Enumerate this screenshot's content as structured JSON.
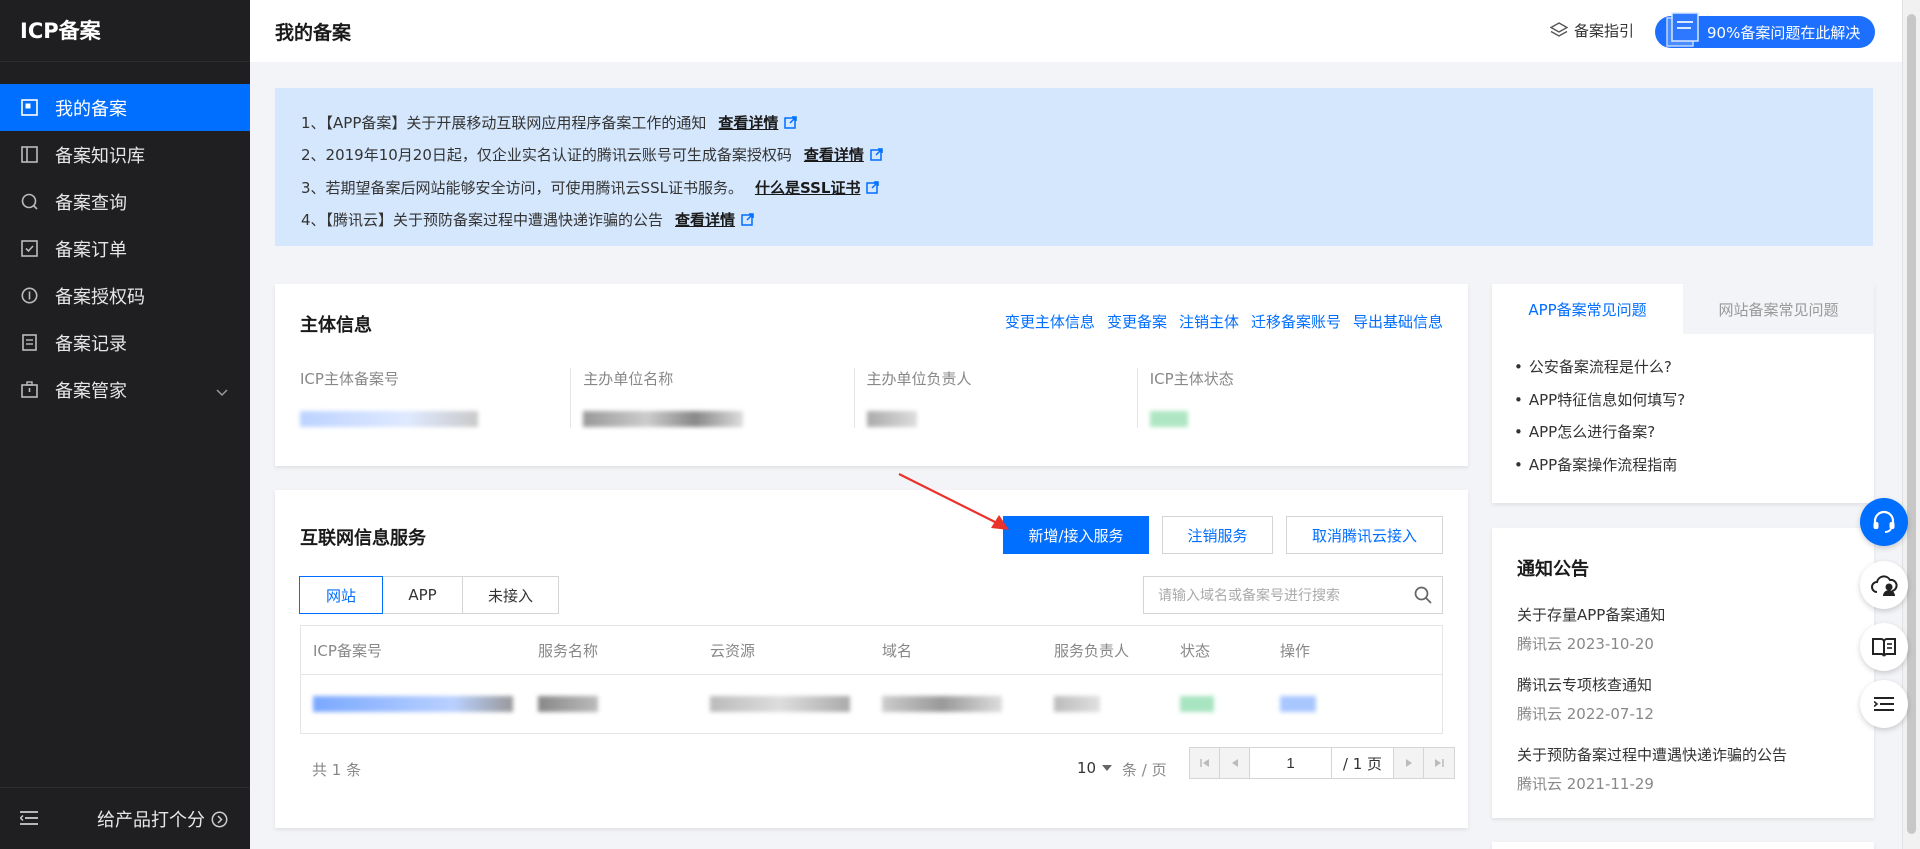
{
  "sidebar": {
    "title": "ICP备案",
    "items": [
      {
        "label": "我的备案"
      },
      {
        "label": "备案知识库"
      },
      {
        "label": "备案查询"
      },
      {
        "label": "备案订单"
      },
      {
        "label": "备案授权码"
      },
      {
        "label": "备案记录"
      },
      {
        "label": "备案管家"
      }
    ],
    "rate_label": "给产品打个分"
  },
  "header": {
    "title": "我的备案",
    "guide_label": "备案指引",
    "promo_label": "90%备案问题在此解决"
  },
  "notices": [
    {
      "text": "1、【APP备案】关于开展移动互联网应用程序备案工作的通知",
      "link": "查看详情"
    },
    {
      "text": "2、2019年10月20日起，仅企业实名认证的腾讯云账号可生成备案授权码",
      "link": "查看详情"
    },
    {
      "text": "3、若期望备案后网站能够安全访问，可使用腾讯云SSL证书服务。",
      "link": "什么是SSL证书"
    },
    {
      "text": "4、【腾讯云】关于预防备案过程中遭遇快递诈骗的公告",
      "link": "查看详情"
    }
  ],
  "subject": {
    "title": "主体信息",
    "actions": [
      "变更主体信息",
      "变更备案",
      "注销主体",
      "迁移备案账号",
      "导出基础信息"
    ],
    "fields": [
      "ICP主体备案号",
      "主办单位名称",
      "主办单位负责人",
      "ICP主体状态"
    ]
  },
  "services": {
    "title": "互联网信息服务",
    "buttons": {
      "add": "新增/接入服务",
      "cancel": "注销服务",
      "unlink": "取消腾讯云接入"
    },
    "tabs": [
      "网站",
      "APP",
      "未接入"
    ],
    "search_placeholder": "请输入域名或备案号进行搜索",
    "columns": [
      "ICP备案号",
      "服务名称",
      "云资源",
      "域名",
      "服务负责人",
      "状态",
      "操作"
    ],
    "pagination": {
      "total_label": "共 1 条",
      "page_size": "10",
      "page_size_unit": "条 / 页",
      "current_page": "1",
      "total_pages": "/ 1 页"
    }
  },
  "faq": {
    "tabs": [
      "APP备案常见问题",
      "网站备案常见问题"
    ],
    "items": [
      "公安备案流程是什么?",
      "APP特征信息如何填写?",
      "APP怎么进行备案?",
      "APP备案操作流程指南"
    ]
  },
  "announcements": {
    "title": "通知公告",
    "items": [
      {
        "title": "关于存量APP备案通知",
        "meta": "腾讯云 2023-10-20"
      },
      {
        "title": "腾讯云专项核查通知",
        "meta": "腾讯云 2022-07-12"
      },
      {
        "title": "关于预防备案过程中遭遇快递诈骗的公告",
        "meta": "腾讯云 2021-11-29"
      }
    ]
  },
  "colors": {
    "primary": "#006eff",
    "sidebar": "#1f1f21",
    "notice_bg": "#d5e7fd",
    "annotation_arrow": "#e8322b"
  }
}
